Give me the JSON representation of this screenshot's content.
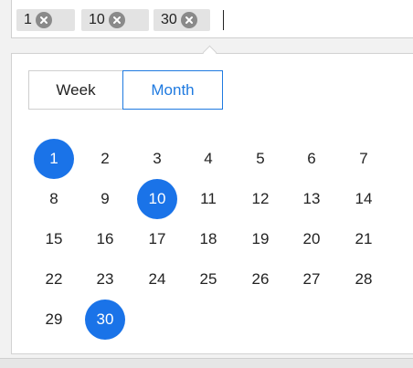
{
  "input": {
    "tags": [
      {
        "label": "1",
        "remove_icon": "close-circle-icon"
      },
      {
        "label": "10",
        "remove_icon": "close-circle-icon"
      },
      {
        "label": "30",
        "remove_icon": "close-circle-icon"
      }
    ]
  },
  "view_toggle": {
    "week_label": "Week",
    "month_label": "Month",
    "selected": "Month"
  },
  "calendar": {
    "days": [
      "1",
      "2",
      "3",
      "4",
      "5",
      "6",
      "7",
      "8",
      "9",
      "10",
      "11",
      "12",
      "13",
      "14",
      "15",
      "16",
      "17",
      "18",
      "19",
      "20",
      "21",
      "22",
      "23",
      "24",
      "25",
      "26",
      "27",
      "28",
      "29",
      "30"
    ],
    "selected_days": [
      "1",
      "10",
      "30"
    ]
  },
  "colors": {
    "accent": "#1a73e8",
    "tag_bg": "#e3e3e3"
  }
}
